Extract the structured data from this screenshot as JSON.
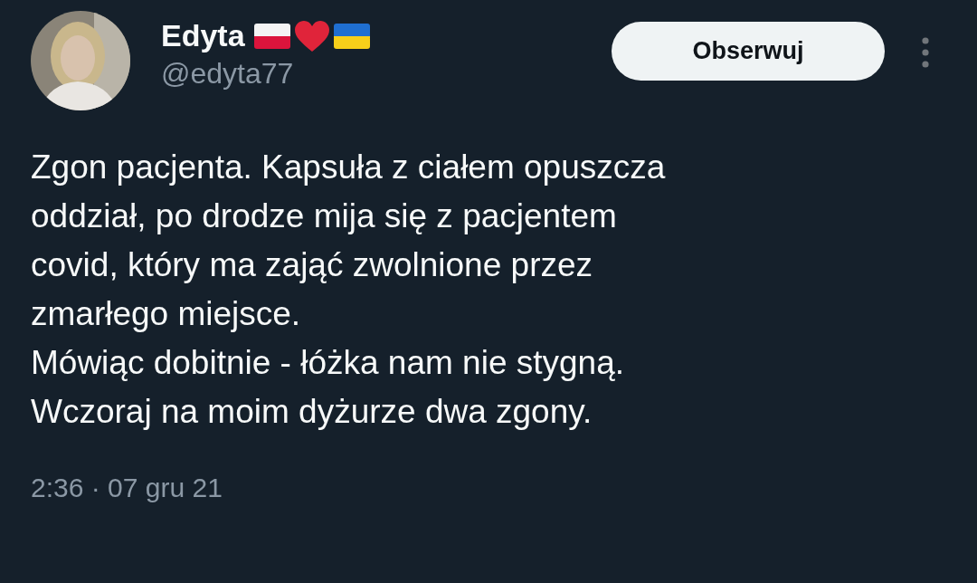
{
  "author": {
    "name": "Edyta",
    "handle": "@edyta77",
    "badges": [
      {
        "kind": "flag-poland"
      },
      {
        "kind": "heart"
      },
      {
        "kind": "flag-ukraine"
      }
    ]
  },
  "follow_button": {
    "label": "Obserwuj"
  },
  "tweet_lines": [
    "Zgon pacjenta. Kapsuła z ciałem opuszcza",
    "oddział, po drodze mija się z pacjentem",
    "covid, który ma zająć zwolnione przez",
    "zmarłego miejsce.",
    "Mówiąc dobitnie - łóżka nam nie stygną.",
    "Wczoraj na moim dyżurze dwa zgony."
  ],
  "timestamp": "2:36 · 07 gru 21"
}
